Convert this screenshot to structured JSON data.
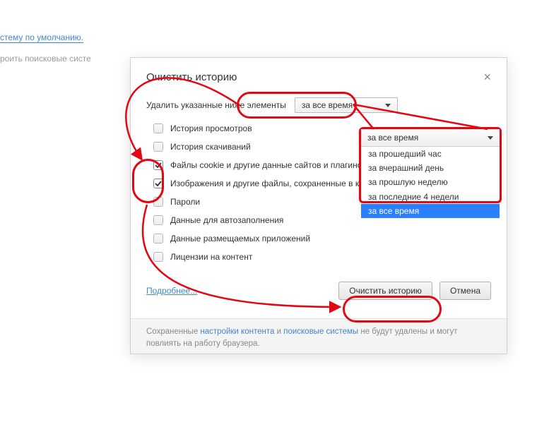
{
  "underLinks": {
    "line1": "стему по умолчанию.",
    "line2": "роить поисковые систе"
  },
  "dialog": {
    "title": "Очистить историю",
    "inlineLabel": "Удалить указанные ниже элементы",
    "selectValue": "за все время",
    "items": [
      {
        "label": "История просмотров",
        "checked": false
      },
      {
        "label": "История скачиваний",
        "checked": false
      },
      {
        "label": "Файлы cookie и другие данные сайтов и плагинов",
        "checked": true
      },
      {
        "label": "Изображения и другие файлы, сохраненные в кеше",
        "checked": true
      },
      {
        "label": "Пароли",
        "checked": false
      },
      {
        "label": "Данные для автозаполнения",
        "checked": false
      },
      {
        "label": "Данные размещаемых приложений",
        "checked": false
      },
      {
        "label": "Лицензии на контент",
        "checked": false
      }
    ],
    "moreLink": "Подробнее...",
    "primaryBtn": "Очистить историю",
    "cancelBtn": "Отмена",
    "foot": {
      "prefix": "Сохраненные ",
      "link1": "настройки контента",
      "mid": " и ",
      "link2": "поисковые системы",
      "suffix": " не будут удалены и могут повлиять на работу браузера."
    }
  },
  "dropdown": {
    "selected": "за все время",
    "options": [
      "за прошедший час",
      "за вчерашний день",
      "за прошлую неделю",
      "за последние 4 недели",
      "за все время"
    ],
    "highlightIndex": 4
  }
}
